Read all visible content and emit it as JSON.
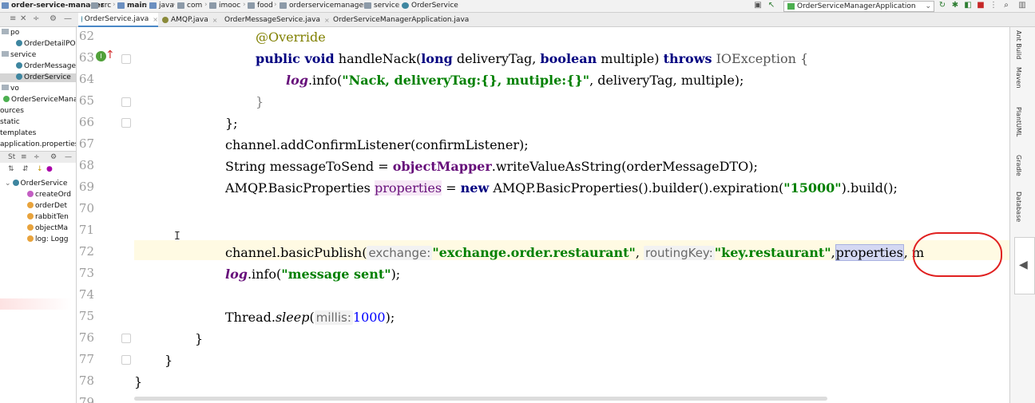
{
  "breadcrumb": [
    "order-service-manager",
    "src",
    "main",
    "java",
    "com",
    "imooc",
    "food",
    "orderservicemanager",
    "service",
    "OrderService"
  ],
  "run_config": "OrderServiceManagerApplication",
  "tabs": [
    {
      "label": "OrderService.java",
      "active": true,
      "color": "#3e86a0"
    },
    {
      "label": "AMQP.java",
      "active": false,
      "color": "#8a8a3a"
    },
    {
      "label": "OrderMessageService.java",
      "active": false,
      "color": "#3e86a0"
    },
    {
      "label": "OrderServiceManagerApplication.java",
      "active": false,
      "color": "#3e86a0"
    }
  ],
  "project_tree": [
    "po",
    "OrderDetailPO",
    "service",
    "OrderMessageS",
    "OrderService",
    "vo",
    "OrderServiceMana",
    "ources",
    "static",
    "templates",
    "application.properties"
  ],
  "structure_toolbar": [
    "St",
    "≡",
    "÷",
    "⚙",
    "—"
  ],
  "structure_items": [
    "OrderService",
    "createOrd",
    "orderDet",
    "rabbitTen",
    "objectMa",
    "log: Logg"
  ],
  "line_numbers": [
    "62",
    "63",
    "64",
    "65",
    "66",
    "67",
    "68",
    "69",
    "70",
    "71",
    "72",
    "73",
    "74",
    "75",
    "76",
    "77",
    "78",
    "79"
  ],
  "code": {
    "l62": "@Override",
    "l63_kw1": "public void",
    "l63_m": " handleNack(",
    "l63_kw2": "long",
    "l63_a": " deliveryTag, ",
    "l63_kw3": "boolean",
    "l63_b": " multiple) ",
    "l63_kw4": "throws",
    "l63_c": " IOException {",
    "l64_log": "log",
    "l64_a": ".info(",
    "l64_str": "\"Nack, deliveryTag:{}, mutiple:{}\"",
    "l64_b": ", deliveryTag, multiple);",
    "l65": "}",
    "l66": "};",
    "l67": "channel.addConfirmListener(confirmListener);",
    "l68_a": "String messageToSend = ",
    "l68_f": "objectMapper",
    "l68_b": ".writeValueAsString(orderMessageDTO);",
    "l69_a": "AMQP.BasicProperties ",
    "l69_p": "properties",
    "l69_b": " = ",
    "l69_kw": "new",
    "l69_c": " AMQP.BasicProperties().builder().expiration(",
    "l69_str": "\"15000\"",
    "l69_d": ").build();",
    "l72_a": "channel.basicPublish(",
    "l72_h1": "exchange:",
    "l72_s1": "\"exchange.order.restaurant\"",
    "l72_b": ", ",
    "l72_h2": "routingKey:",
    "l72_s2": "\"key.restaurant\"",
    "l72_c": ",",
    "l72_sel": "properties",
    "l72_d": ", m",
    "l73_log": "log",
    "l73_a": ".info(",
    "l73_str": "\"message sent\"",
    "l73_b": ");",
    "l75_a": "Thread.",
    "l75_m": "sleep",
    "l75_b": "(",
    "l75_h": "millis:",
    "l75_n": "1000",
    "l75_c": ");",
    "l76": "}",
    "l77": "}",
    "l78": "}"
  },
  "right_tools": [
    "Ant Build",
    "Maven",
    "PlantUML",
    "Gradle",
    "Database"
  ]
}
